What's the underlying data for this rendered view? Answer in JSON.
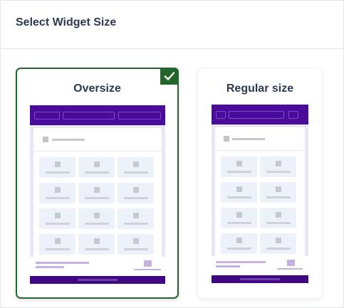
{
  "header": {
    "title": "Select Widget Size"
  },
  "options": [
    {
      "title": "Oversize",
      "selected": true
    },
    {
      "title": "Regular size",
      "selected": false
    }
  ],
  "icons": {
    "selected_badge": "check-icon"
  },
  "colors": {
    "selected_border": "#22662a",
    "preview_header": "#4a0a9a",
    "preview_footer": "#3f0880",
    "tile_background": "#edf1f9"
  }
}
